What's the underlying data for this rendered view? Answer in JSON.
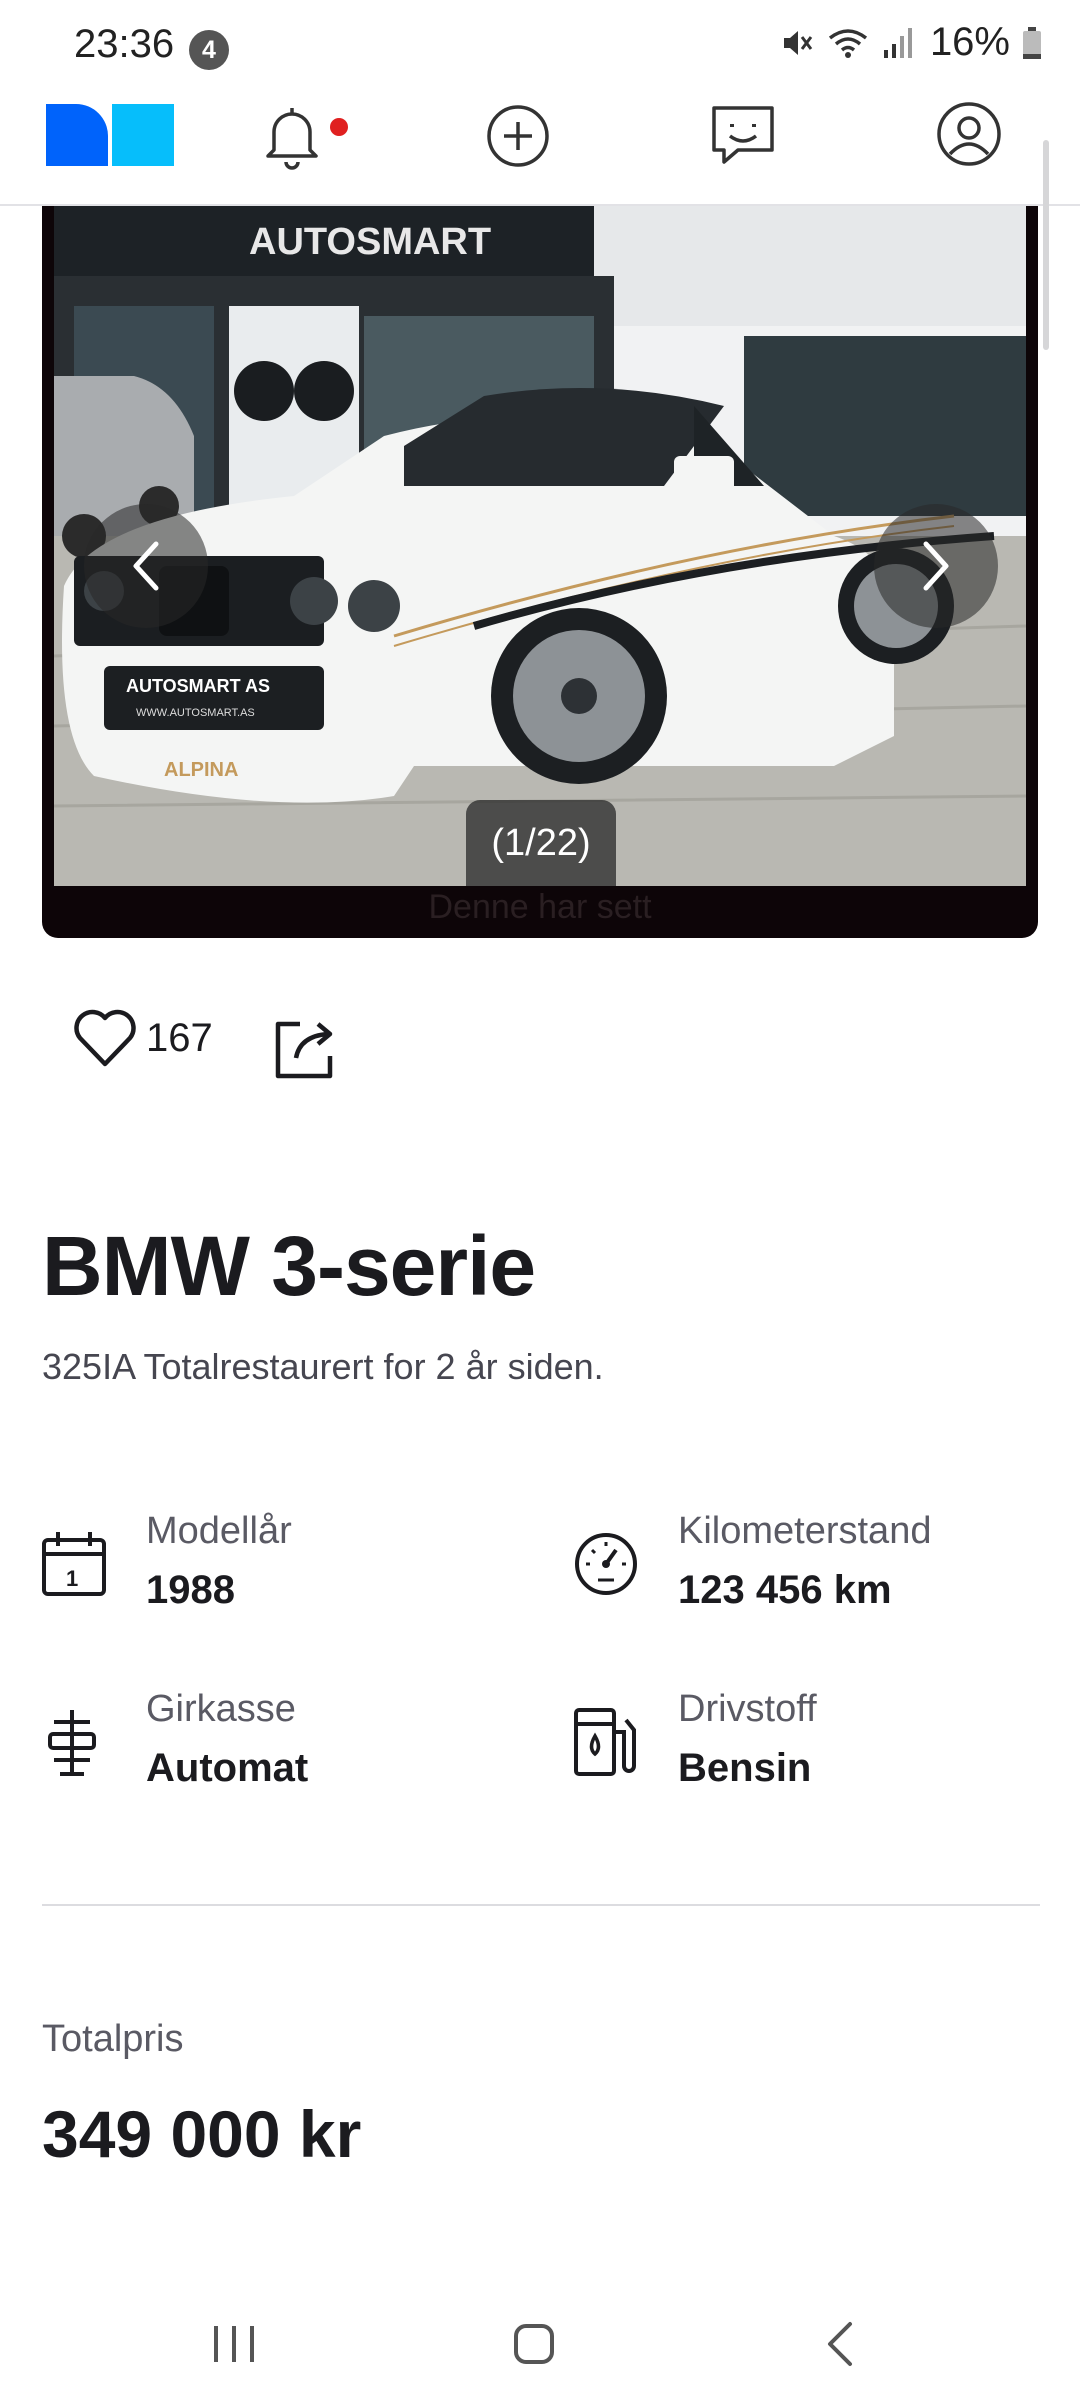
{
  "status_bar": {
    "time": "23:36",
    "notification_count": "4",
    "battery_percent": "16%"
  },
  "nav": {
    "items": [
      "logo",
      "notifications",
      "new-ad",
      "messages",
      "profile"
    ],
    "has_unread_notification": true
  },
  "gallery": {
    "counter": "(1/22)",
    "caption": "Denne har sett"
  },
  "actions": {
    "favorite_count": "167"
  },
  "listing": {
    "title": "BMW 3-serie",
    "subtitle": "325IA Totalrestaurert for 2 år siden."
  },
  "specs": [
    {
      "label": "Modellår",
      "value": "1988",
      "icon": "calendar-icon"
    },
    {
      "label": "Kilometerstand",
      "value": "123 456 km",
      "icon": "speedometer-icon"
    },
    {
      "label": "Girkasse",
      "value": "Automat",
      "icon": "gearbox-icon"
    },
    {
      "label": "Drivstoff",
      "value": "Bensin",
      "icon": "fuel-pump-icon"
    }
  ],
  "price": {
    "label": "Totalpris",
    "value": "349 000 kr"
  },
  "photo_text": {
    "dealer_sign": "AUTOSMART",
    "plate_line1": "AUTOSMART AS",
    "plate_line2": "WWW.AUTOSMART.AS",
    "spoiler_text": "ALPINA"
  },
  "colors": {
    "brand_dark": "#0063fb",
    "brand_light": "#06befb",
    "notification_dot": "#e02020"
  }
}
